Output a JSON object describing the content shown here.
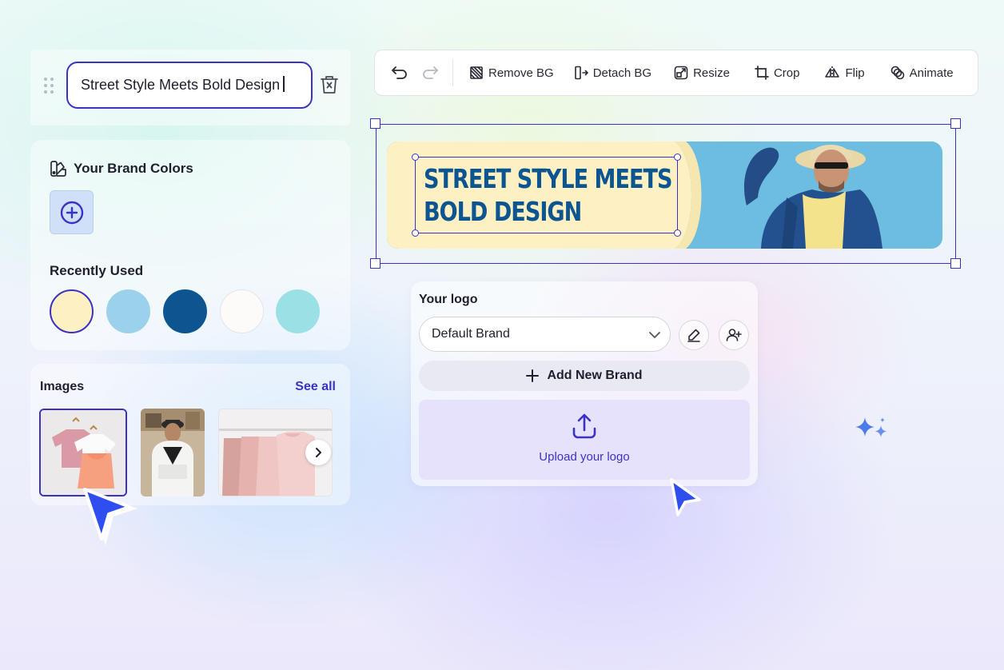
{
  "title_field": {
    "value": "Street Style Meets Bold Design"
  },
  "brand_colors": {
    "heading": "Your Brand Colors",
    "recently_used_label": "Recently Used",
    "recent_colors": [
      "#fdf0c2",
      "#9bd1ea",
      "#0d5590",
      "#fdfafa",
      "#9be0e5"
    ]
  },
  "images": {
    "heading": "Images",
    "see_all": "See all"
  },
  "toolbar": {
    "remove_bg": "Remove BG",
    "detach_bg": "Detach BG",
    "resize": "Resize",
    "crop": "Crop",
    "flip": "Flip",
    "animate": "Animate"
  },
  "banner": {
    "headline_line1": "STREET STYLE MEETS",
    "headline_line2": "BOLD DESIGN"
  },
  "logo": {
    "heading": "Your logo",
    "selected_brand": "Default Brand",
    "add_brand": "Add New Brand",
    "upload": "Upload your logo"
  },
  "colors": {
    "accent": "#3b32c5",
    "banner_text": "#0d5590",
    "banner_cream": "#fdf0c2",
    "banner_blue": "#62b7dc"
  }
}
